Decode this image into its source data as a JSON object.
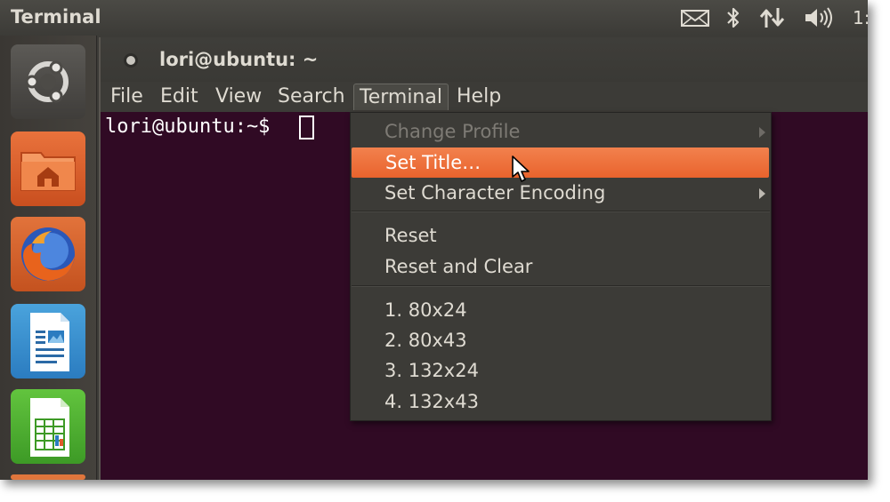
{
  "top_panel": {
    "title": "Terminal",
    "clock": "1:"
  },
  "launcher": {
    "items": [
      {
        "name": "dash-home",
        "icon": "ubuntu-logo-icon"
      },
      {
        "name": "home-folder",
        "icon": "home-folder-icon"
      },
      {
        "name": "firefox",
        "icon": "firefox-icon"
      },
      {
        "name": "libreoffice-writer",
        "icon": "writer-document-icon"
      },
      {
        "name": "libreoffice-calc",
        "icon": "calc-spreadsheet-icon"
      }
    ]
  },
  "window": {
    "title": "lori@ubuntu: ~",
    "menus": [
      "File",
      "Edit",
      "View",
      "Search",
      "Terminal",
      "Help"
    ],
    "prompt": "lori@ubuntu:~$ "
  },
  "terminal_menu": {
    "items": [
      {
        "label": "Change Profile",
        "state": "disabled",
        "submenu": true
      },
      {
        "label": "Set Title…",
        "state": "highlighted",
        "submenu": false
      },
      {
        "label": "Set Character Encoding",
        "state": "normal",
        "submenu": true
      },
      {
        "label": "Reset",
        "state": "normal",
        "submenu": false
      },
      {
        "label": "Reset and Clear",
        "state": "normal",
        "submenu": false
      },
      {
        "label": "1. 80x24",
        "state": "normal",
        "submenu": false
      },
      {
        "label": "2. 80x43",
        "state": "normal",
        "submenu": false
      },
      {
        "label": "3. 132x24",
        "state": "normal",
        "submenu": false
      },
      {
        "label": "4. 132x43",
        "state": "normal",
        "submenu": false
      }
    ]
  },
  "colors": {
    "terminal_bg": "#300a24",
    "highlight": "#f07746",
    "panel": "#3c3b37",
    "text": "#dfdbd2"
  }
}
